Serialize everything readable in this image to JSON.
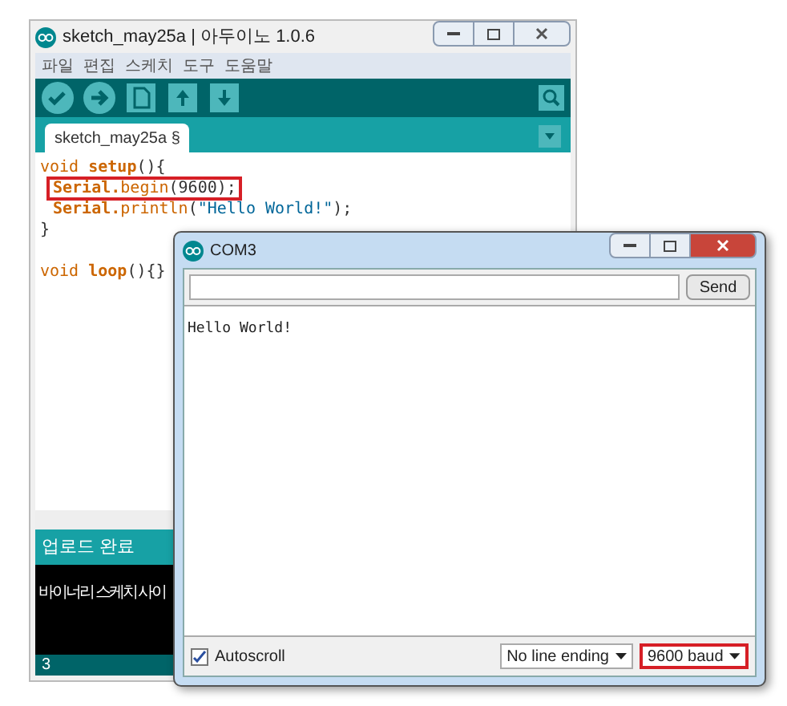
{
  "ide": {
    "title": "sketch_may25a | 아두이노 1.0.6",
    "menu": [
      "파일",
      "편집",
      "스케치",
      "도구",
      "도움말"
    ],
    "toolbar": [
      {
        "kind": "verify"
      },
      {
        "kind": "upload"
      },
      {
        "kind": "new"
      },
      {
        "kind": "open"
      },
      {
        "kind": "save"
      }
    ],
    "tab": {
      "label": "sketch_may25a §",
      "selected": true
    },
    "code": [
      {
        "highlighted": false,
        "tokens": [
          {
            "kind": "type",
            "text": "void "
          },
          {
            "kind": "func",
            "text": "setup"
          },
          {
            "kind": "plain",
            "text": "(){"
          }
        ]
      },
      {
        "highlighted": true,
        "tokens": [
          {
            "kind": "class",
            "text": "Serial."
          },
          {
            "kind": "method",
            "text": "begin"
          },
          {
            "kind": "plain",
            "text": "(9600);"
          }
        ]
      },
      {
        "highlighted": false,
        "tokens": [
          {
            "kind": "class",
            "text": "Serial."
          },
          {
            "kind": "method",
            "text": "println"
          },
          {
            "kind": "plain",
            "text": "("
          },
          {
            "kind": "string",
            "text": "\"Hello World!\""
          },
          {
            "kind": "plain",
            "text": ");"
          }
        ]
      },
      {
        "highlighted": false,
        "tokens": [
          {
            "kind": "plain",
            "text": "}"
          }
        ]
      },
      {
        "highlighted": false
      },
      {
        "highlighted": false,
        "tokens": [
          {
            "kind": "type",
            "text": "void "
          },
          {
            "kind": "func",
            "text": "loop"
          },
          {
            "kind": "plain",
            "text": "(){}"
          }
        ]
      }
    ],
    "status": "업로드 완료",
    "console": "바이너리 스케치 사이",
    "line_number": "3"
  },
  "monitor": {
    "title": "COM3",
    "send": "Send",
    "output": "Hello World!",
    "autoscroll": {
      "label": "Autoscroll",
      "checked": true
    },
    "selects": [
      {
        "value": "No line ending",
        "highlighted": false
      },
      {
        "value": "9600 baud",
        "highlighted": true
      }
    ]
  }
}
